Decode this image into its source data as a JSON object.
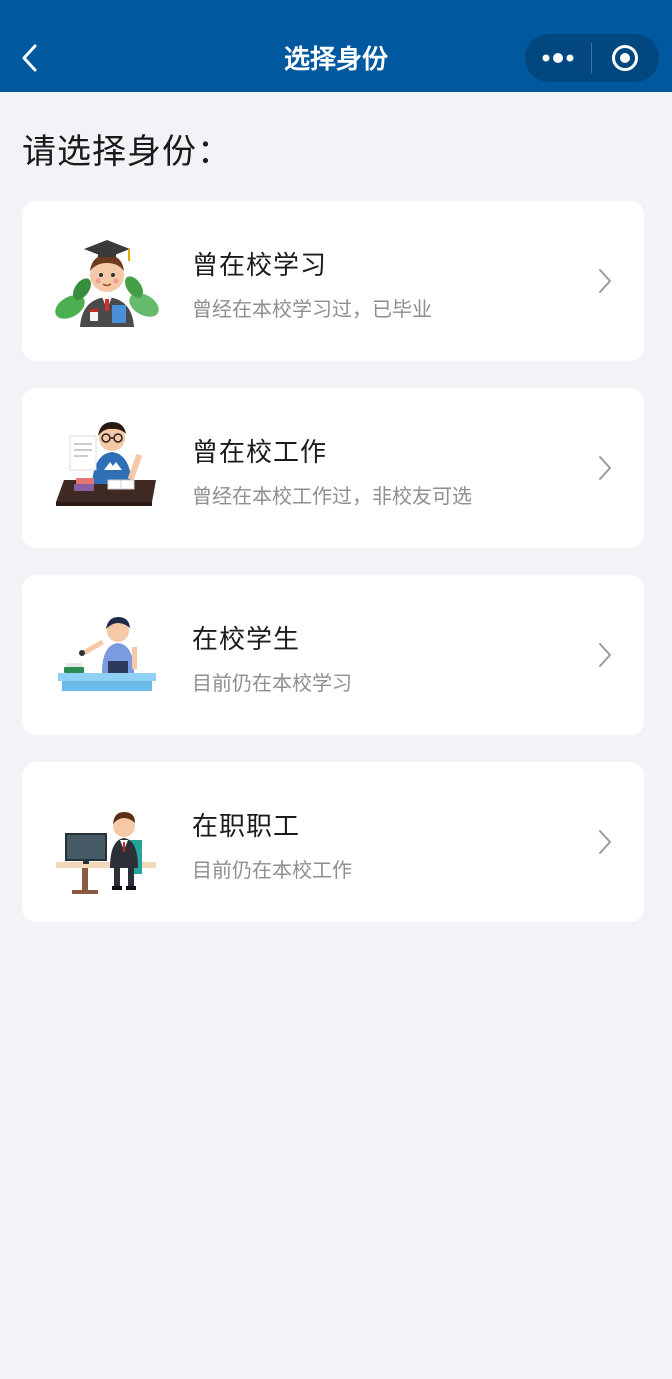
{
  "nav": {
    "title": "选择身份",
    "more_icon": "more-dots-icon",
    "close_icon": "target-circle-icon"
  },
  "prompt": "请选择身份：",
  "options": [
    {
      "title": "曾在校学习",
      "subtitle": "曾经在本校学习过，已毕业",
      "illustration": "graduate-illustration"
    },
    {
      "title": "曾在校工作",
      "subtitle": "曾经在本校工作过，非校友可选",
      "illustration": "teacher-at-desk-illustration"
    },
    {
      "title": "在校学生",
      "subtitle": "目前仍在本校学习",
      "illustration": "student-at-desk-illustration"
    },
    {
      "title": "在职职工",
      "subtitle": "目前仍在本校工作",
      "illustration": "staff-at-computer-illustration"
    }
  ],
  "colors": {
    "nav_bg": "#00589e",
    "page_bg": "#f2f3f7",
    "card_bg": "#ffffff"
  }
}
